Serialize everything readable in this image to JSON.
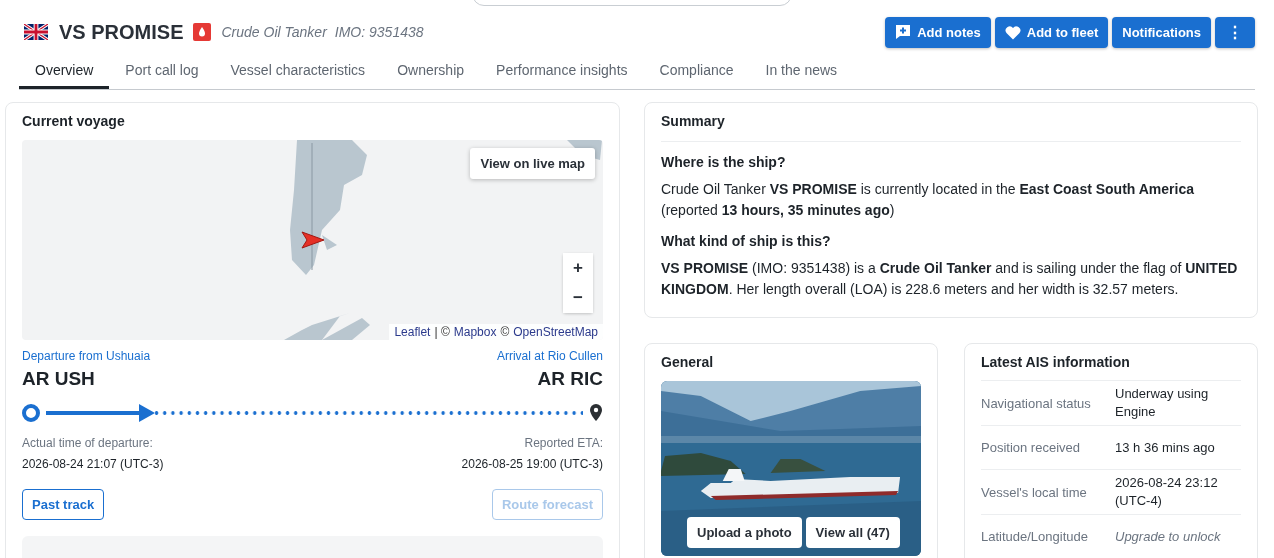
{
  "vessel": {
    "name": "VS PROMISE",
    "type": "Crude Oil Tanker",
    "imo": "IMO: 9351438"
  },
  "actions": [
    {
      "label": "Add notes",
      "kind": "notes"
    },
    {
      "label": "Add to fleet",
      "kind": "fleet"
    },
    {
      "label": "Notifications",
      "kind": "plain"
    },
    {
      "label": "⋮",
      "kind": "more"
    }
  ],
  "tabs": [
    {
      "label": "Overview",
      "selected": true
    },
    {
      "label": "Port call log",
      "selected": false
    },
    {
      "label": "Vessel characteristics",
      "selected": false
    },
    {
      "label": "Ownership",
      "selected": false
    },
    {
      "label": "Performance insights",
      "selected": false
    },
    {
      "label": "Compliance",
      "selected": false
    },
    {
      "label": "In the news",
      "selected": false
    }
  ],
  "current_voyage": {
    "title": "Current voyage",
    "map": {
      "live_button": "View on live map",
      "zoom_in": "+",
      "zoom_out": "−",
      "attribution": [
        {
          "text": "Leaflet",
          "link": true
        },
        {
          "text": "| ©",
          "link": false
        },
        {
          "text": "Mapbox",
          "link": true
        },
        {
          "text": "©",
          "link": false
        },
        {
          "text": "OpenStreetMap",
          "link": true
        }
      ]
    },
    "departure": {
      "label": "Departure from Ushuaia",
      "code": "AR USH",
      "time_label": "Actual time of departure:",
      "time": "2026-08-24 21:07 (UTC-3)"
    },
    "arrival": {
      "label": "Arrival at Rio Cullen",
      "code": "AR RIC",
      "time_label": "Reported ETA:",
      "time": "2026-08-25 19:00 (UTC-3)"
    },
    "progress": {
      "level": 0.18
    },
    "buttons": [
      {
        "label": "Past track",
        "disabled": false
      },
      {
        "label": "Route forecast",
        "disabled": true
      }
    ]
  },
  "summary": {
    "title": "Summary",
    "sections": [
      {
        "heading": "Where is the ship?",
        "text": "Crude Oil Tanker **VS PROMISE** is currently located in the **East Coast South America** (reported **13 hours, 35 minutes ago**)"
      },
      {
        "heading": "What kind of ship is this?",
        "text": "**VS PROMISE** (IMO: 9351438) is a **Crude Oil Tanker** and is sailing under the flag of **UNITED KINGDOM**. Her length overall (LOA) is 228.6 meters and her width is 32.57 meters."
      }
    ]
  },
  "general": {
    "title": "General",
    "buttons": [
      "Upload a photo",
      "View all (47)"
    ]
  },
  "ais": {
    "title": "Latest AIS information",
    "rows": [
      {
        "label": "Navigational status",
        "value": "Underway using Engine",
        "locked": false
      },
      {
        "label": "Position received",
        "value": "13 h 36 mins ago",
        "locked": false
      },
      {
        "label": "Vessel's local time",
        "value": "2026-08-24 23:12 (UTC-4)",
        "locked": false
      },
      {
        "label": "Latitude/Longitude",
        "value": "Upgrade to unlock",
        "locked": true
      }
    ]
  }
}
